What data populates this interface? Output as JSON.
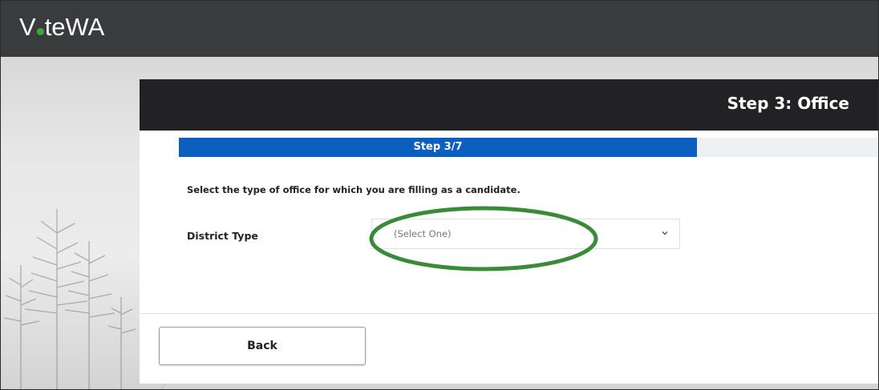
{
  "header": {
    "logo_text_v": "V",
    "logo_text_rest": "teWA",
    "brand_dot_color": "#3aaa35"
  },
  "wizard": {
    "title": "Step 3: Office",
    "progress_label": "Step 3/7",
    "progress_fraction": 0.428,
    "progress_color": "#0b5fc1"
  },
  "form": {
    "instruction": "Select the type of office for which you are filling as a candidate.",
    "district_type_label": "District Type",
    "district_type_value": "(Select One)",
    "highlight_color": "#3a8a3a"
  },
  "footer": {
    "back_label": "Back"
  },
  "icons": {
    "select_chevron": "chevron-down-icon"
  }
}
